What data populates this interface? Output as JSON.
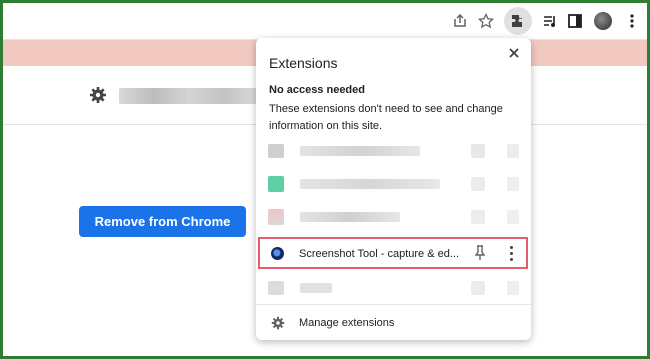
{
  "popup": {
    "title": "Extensions",
    "close_icon": "close-icon",
    "section_heading": "No access needed",
    "section_description": "These extensions don't need to see and change information on this site.",
    "highlighted_extension": {
      "name": "Screenshot Tool - capture & ed...",
      "icon": "screenshot-tool-logo",
      "pin_icon": "pin-icon",
      "menu_icon": "more-vert-icon"
    },
    "manage_label": "Manage extensions",
    "manage_icon": "gear-icon"
  },
  "page": {
    "remove_button_label": "Remove from Chrome",
    "settings_icon": "gear-icon"
  },
  "toolbar": {
    "icons": [
      "share-icon",
      "star-icon",
      "puzzle-icon",
      "media-queue-icon",
      "side-panel-icon",
      "avatar",
      "more-vert-icon"
    ]
  },
  "colors": {
    "frame_border": "#2e7d32",
    "banner": "#f2c9c0",
    "primary_button": "#1a73e8",
    "highlight_border": "#e35d6a"
  }
}
